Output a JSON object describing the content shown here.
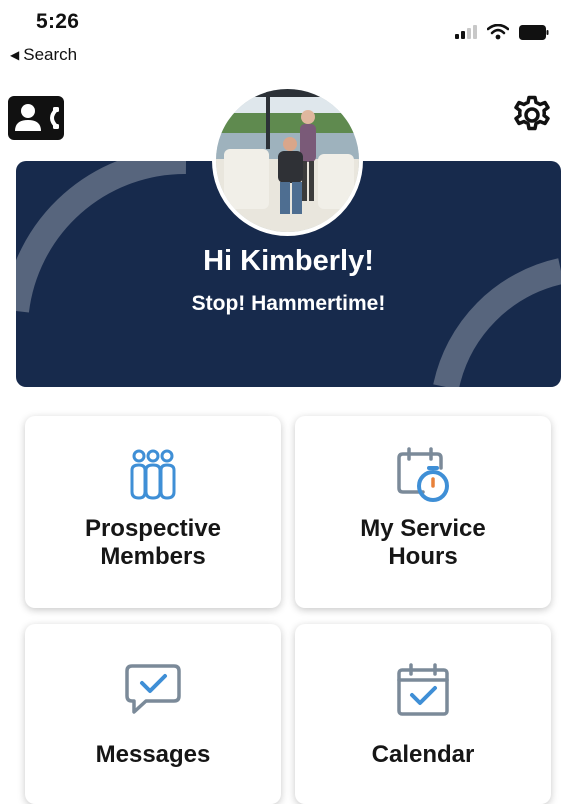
{
  "status_bar": {
    "time": "5:26",
    "back_label": "Search",
    "icons": [
      "cellular-signal-icon",
      "wifi-icon",
      "battery-icon"
    ]
  },
  "header": {
    "left_icon": "contacts-icon",
    "right_icon": "gear-icon"
  },
  "banner": {
    "greeting": "Hi Kimberly!",
    "subtitle": "Stop! Hammertime!",
    "background_color": "#172a4c"
  },
  "tiles": [
    {
      "label_line1": "Prospective",
      "label_line2": "Members",
      "icon": "people-icon"
    },
    {
      "label_line1": "My Service",
      "label_line2": "Hours",
      "icon": "calendar-stopwatch-icon"
    },
    {
      "label_line1": "Messages",
      "icon": "message-check-icon"
    },
    {
      "label_line1": "Calendar",
      "icon": "calendar-check-icon"
    }
  ],
  "colors": {
    "accent_blue": "#3f8fd6",
    "icon_gray": "#7b8a99",
    "accent_orange": "#e8813a"
  }
}
